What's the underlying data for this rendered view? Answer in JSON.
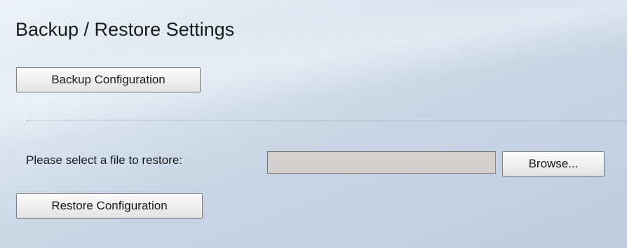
{
  "page": {
    "title": "Backup / Restore Settings"
  },
  "backup": {
    "button_label": "Backup Configuration"
  },
  "restore": {
    "select_label": "Please select a file to restore:",
    "file_value": "",
    "browse_label": "Browse...",
    "button_label": "Restore Configuration"
  },
  "colors": {
    "background": "#bccde0",
    "file_field": "#d4d0d0",
    "divider": "#9a9ad6"
  }
}
